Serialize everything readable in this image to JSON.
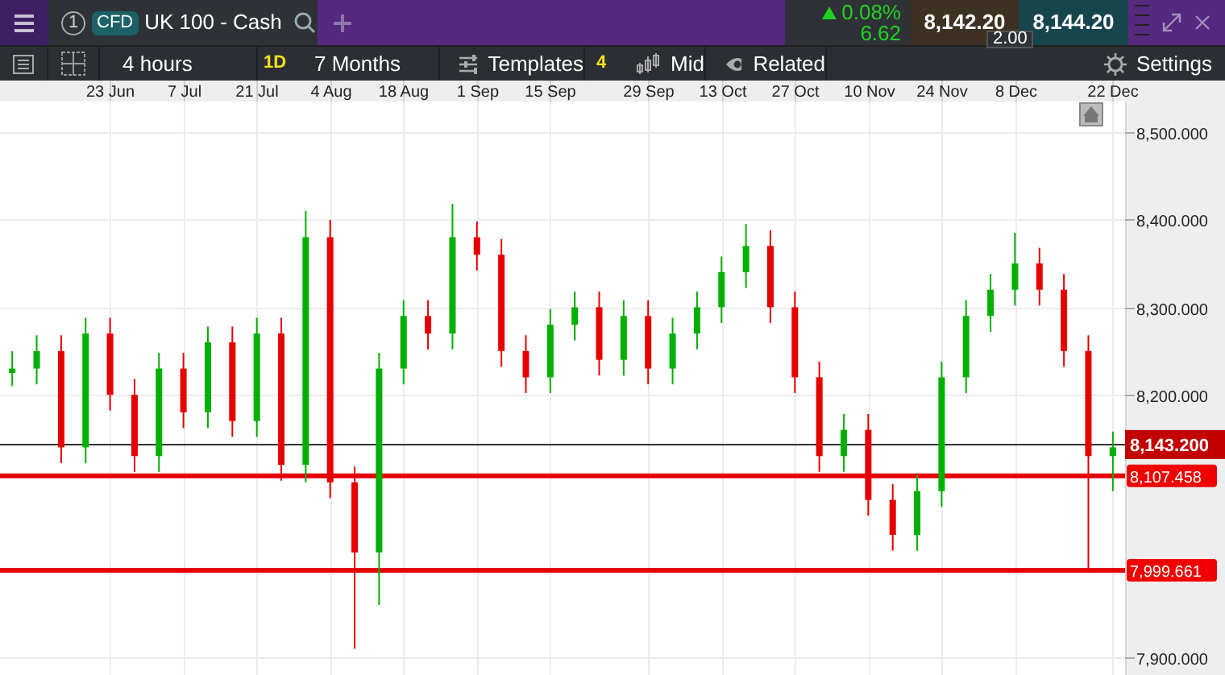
{
  "tab": {
    "number": "1",
    "badge": "CFD",
    "title": "UK 100 - Cash"
  },
  "quote": {
    "change_pct": "0.08%",
    "change": "6.62",
    "sell": "8,142.20",
    "buy": "8,144.20",
    "spread": "2.00"
  },
  "toolbar": [
    {
      "kind": "icon"
    },
    {
      "kind": "layout"
    },
    {
      "kind": "text",
      "label": "4 hours"
    },
    {
      "kind": "badge",
      "label": "1D"
    },
    {
      "kind": "text",
      "label": "7 Months"
    },
    {
      "kind": "templates",
      "label": "Templates"
    },
    {
      "kind": "badge",
      "label": "4"
    },
    {
      "kind": "mid",
      "label": "Mid"
    },
    {
      "kind": "related",
      "label": "Related"
    },
    {
      "kind": "settings",
      "label": "Settings"
    }
  ],
  "chart_data": {
    "type": "candlestick",
    "ylim": [
      7880,
      8535
    ],
    "grid": true,
    "yticks": [
      {
        "value": 8500,
        "label": "8,500.000"
      },
      {
        "value": 8400,
        "label": "8,400.000"
      },
      {
        "value": 8300,
        "label": "8,300.000"
      },
      {
        "value": 8200,
        "label": "8,200.000"
      },
      {
        "value": 7900,
        "label": "7,900.000"
      }
    ],
    "categories": [
      null,
      null,
      null,
      null,
      "23 Jun",
      null,
      null,
      "7 Jul",
      null,
      null,
      "21 Jul",
      null,
      null,
      "4 Aug",
      null,
      null,
      "18 Aug",
      null,
      null,
      "1 Sep",
      null,
      null,
      "15 Sep",
      null,
      null,
      null,
      "29 Sep",
      null,
      null,
      "13 Oct",
      null,
      null,
      "27 Oct",
      null,
      null,
      "10 Nov",
      null,
      null,
      "24 Nov",
      null,
      null,
      "8 Dec",
      null,
      null,
      null,
      "22 Dec"
    ],
    "ohlc": [
      [
        8225,
        8250,
        8210,
        8230
      ],
      [
        8230,
        8268,
        8212,
        8250
      ],
      [
        8250,
        8268,
        8122,
        8140
      ],
      [
        8140,
        8288,
        8122,
        8270
      ],
      [
        8270,
        8288,
        8182,
        8200
      ],
      [
        8200,
        8218,
        8112,
        8130
      ],
      [
        8130,
        8248,
        8112,
        8230
      ],
      [
        8230,
        8248,
        8162,
        8180
      ],
      [
        8180,
        8278,
        8162,
        8260
      ],
      [
        8260,
        8278,
        8152,
        8170
      ],
      [
        8170,
        8288,
        8152,
        8270
      ],
      [
        8270,
        8288,
        8102,
        8120
      ],
      [
        8120,
        8410,
        8100,
        8380
      ],
      [
        8380,
        8400,
        8082,
        8100
      ],
      [
        8100,
        8118,
        7910,
        8020
      ],
      [
        8020,
        8248,
        7960,
        8230
      ],
      [
        8230,
        8308,
        8212,
        8290
      ],
      [
        8290,
        8308,
        8252,
        8270
      ],
      [
        8270,
        8418,
        8252,
        8380
      ],
      [
        8380,
        8398,
        8342,
        8360
      ],
      [
        8360,
        8378,
        8232,
        8250
      ],
      [
        8250,
        8268,
        8202,
        8220
      ],
      [
        8220,
        8298,
        8202,
        8280
      ],
      [
        8280,
        8318,
        8262,
        8300
      ],
      [
        8300,
        8318,
        8222,
        8240
      ],
      [
        8240,
        8308,
        8222,
        8290
      ],
      [
        8290,
        8308,
        8212,
        8230
      ],
      [
        8230,
        8288,
        8212,
        8270
      ],
      [
        8270,
        8318,
        8252,
        8300
      ],
      [
        8300,
        8358,
        8282,
        8340
      ],
      [
        8340,
        8395,
        8322,
        8370
      ],
      [
        8370,
        8388,
        8282,
        8300
      ],
      [
        8300,
        8318,
        8202,
        8220
      ],
      [
        8220,
        8238,
        8112,
        8130
      ],
      [
        8130,
        8178,
        8112,
        8160
      ],
      [
        8160,
        8178,
        8062,
        8080
      ],
      [
        8080,
        8098,
        8022,
        8040
      ],
      [
        8040,
        8108,
        8022,
        8090
      ],
      [
        8090,
        8238,
        8072,
        8220
      ],
      [
        8220,
        8308,
        8202,
        8290
      ],
      [
        8290,
        8338,
        8272,
        8320
      ],
      [
        8320,
        8385,
        8302,
        8350
      ],
      [
        8350,
        8368,
        8302,
        8320
      ],
      [
        8320,
        8338,
        8232,
        8250
      ],
      [
        8250,
        8268,
        8000,
        8130
      ],
      [
        8130,
        8158,
        8090,
        8140
      ]
    ],
    "ref_lines": [
      {
        "axis": "y",
        "value": 8143.2,
        "label": "8,143.200",
        "color": "#333333"
      },
      {
        "axis": "y",
        "value": 8107.458,
        "label": "8,107.458",
        "color": "#e60000"
      },
      {
        "axis": "y",
        "value": 7999.661,
        "label": "7,999.661",
        "color": "#e60000"
      }
    ]
  }
}
